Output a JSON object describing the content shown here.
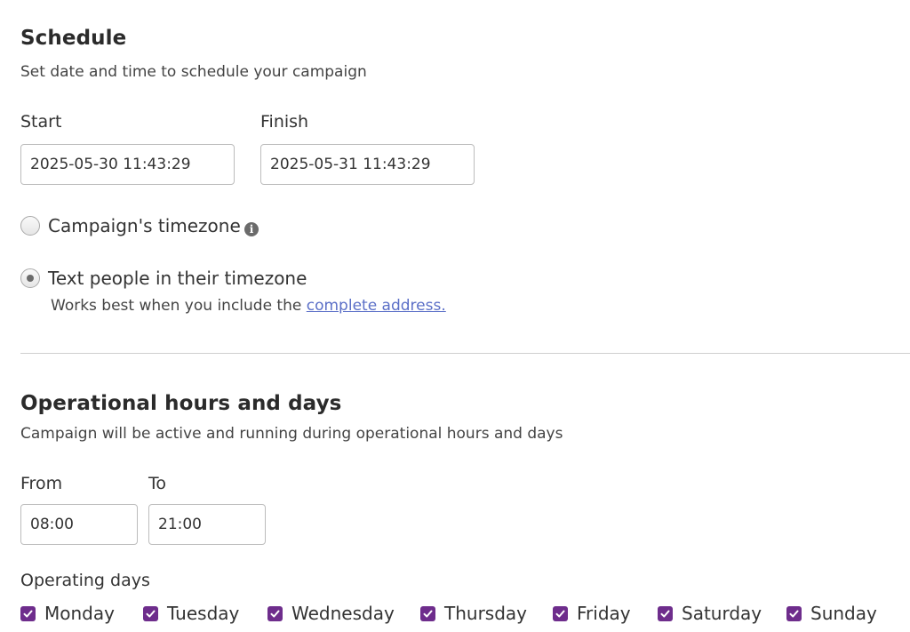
{
  "schedule": {
    "title": "Schedule",
    "subtitle": "Set date and time to schedule your campaign",
    "start_label": "Start",
    "start_value": "2025-05-30 11:43:29",
    "finish_label": "Finish",
    "finish_value": "2025-05-31 11:43:29",
    "timezone_options": [
      {
        "label": "Campaign's timezone",
        "checked": false
      },
      {
        "label": "Text people in their timezone",
        "checked": true
      }
    ],
    "note_prefix": "Works best when you include the",
    "note_link": "complete address."
  },
  "operational": {
    "title": "Operational hours and days",
    "subtitle": "Campaign will be active and running during operational hours and days",
    "from_label": "From",
    "from_value": "08:00",
    "to_label": "To",
    "to_value": "21:00",
    "days_label": "Operating days",
    "days": [
      {
        "label": "Monday",
        "checked": true
      },
      {
        "label": "Tuesday",
        "checked": true
      },
      {
        "label": "Wednesday",
        "checked": true
      },
      {
        "label": "Thursday",
        "checked": true
      },
      {
        "label": "Friday",
        "checked": true
      },
      {
        "label": "Saturday",
        "checked": true
      },
      {
        "label": "Sunday",
        "checked": true
      }
    ]
  },
  "colors": {
    "checkbox": "#6e2d8c",
    "link": "#5b6fc7"
  },
  "icons": {
    "info": "info-icon",
    "check": "check-icon"
  }
}
